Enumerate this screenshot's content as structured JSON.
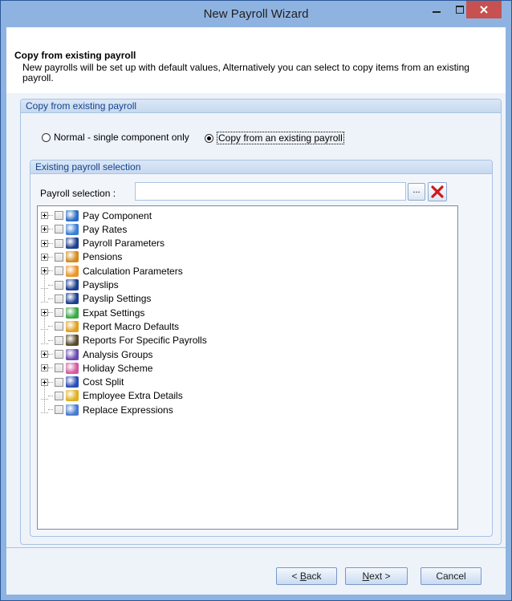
{
  "window": {
    "title": "New Payroll Wizard",
    "minimize": "–",
    "maximize": "☐",
    "close": "✕"
  },
  "header": {
    "title": "Copy from existing payroll",
    "description": "New payrolls will be set up with default values, Alternatively you can select to copy items from an existing payroll."
  },
  "copy_group": {
    "title": "Copy from existing payroll",
    "option_normal": "Normal - single component only",
    "option_copy": "Copy from an existing payroll",
    "selected": "Copy from an existing payroll"
  },
  "selection_group": {
    "title": "Existing payroll selection",
    "payroll_label": "Payroll selection :",
    "payroll_value": "",
    "browse_label": "...",
    "tree": [
      {
        "label": "Pay Component",
        "expandable": true,
        "icon_color": "#2b6cc4"
      },
      {
        "label": "Pay Rates",
        "expandable": true,
        "icon_color": "#3a7fd5"
      },
      {
        "label": "Payroll Parameters",
        "expandable": true,
        "icon_color": "#1d3f8f"
      },
      {
        "label": "Pensions",
        "expandable": true,
        "icon_color": "#d38b1e"
      },
      {
        "label": "Calculation Parameters",
        "expandable": true,
        "icon_color": "#e8962c"
      },
      {
        "label": "Payslips",
        "expandable": false,
        "icon_color": "#1d3f8f"
      },
      {
        "label": "Payslip Settings",
        "expandable": false,
        "icon_color": "#1d3f8f"
      },
      {
        "label": "Expat Settings",
        "expandable": true,
        "icon_color": "#3aa845"
      },
      {
        "label": "Report Macro Defaults",
        "expandable": false,
        "icon_color": "#e0a020"
      },
      {
        "label": "Reports For Specific Payrolls",
        "expandable": false,
        "icon_color": "#5a4a2a"
      },
      {
        "label": "Analysis Groups",
        "expandable": true,
        "icon_color": "#6a4ab0"
      },
      {
        "label": "Holiday Scheme",
        "expandable": true,
        "icon_color": "#d35aa0"
      },
      {
        "label": "Cost Split",
        "expandable": true,
        "icon_color": "#2b4fb8"
      },
      {
        "label": "Employee Extra Details",
        "expandable": false,
        "icon_color": "#e0b020"
      },
      {
        "label": "Replace Expressions",
        "expandable": false,
        "icon_color": "#4a7ad0"
      }
    ]
  },
  "footer": {
    "back": {
      "prefix": "< ",
      "mnemonic": "B",
      "rest": "ack"
    },
    "next": {
      "mnemonic": "N",
      "rest": "ext >"
    },
    "cancel": "Cancel"
  }
}
